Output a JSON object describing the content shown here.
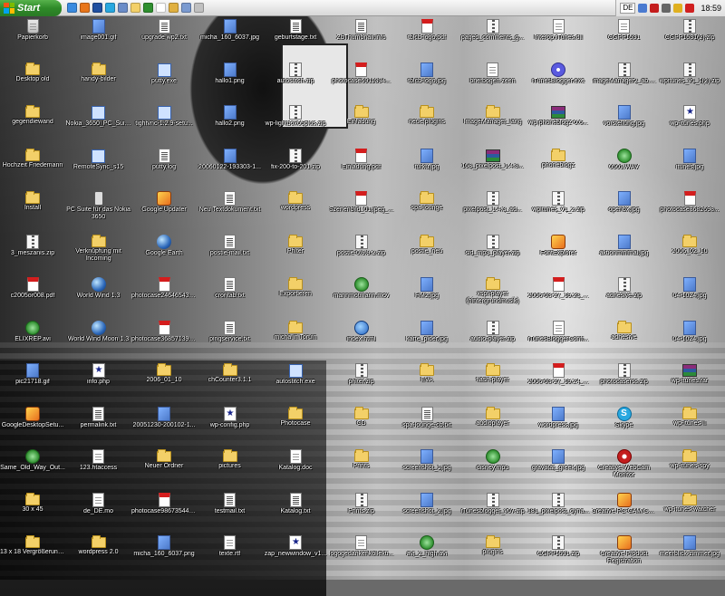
{
  "taskbar": {
    "start_label": "Start",
    "language": "DE",
    "clock": "18:59",
    "quick_launch": [
      "ie-icon",
      "firefox-icon",
      "outlook-icon",
      "skype-icon",
      "desktop-icon",
      "explorer-icon",
      "media-icon",
      "notepad-icon",
      "folder-icon",
      "network-icon",
      "app-icon"
    ],
    "tray_icons": [
      "network-icon",
      "adobe-icon",
      "speaker-icon",
      "safety-icon",
      "antivirus-icon"
    ]
  },
  "desktop": {
    "icons": [
      {
        "label": "Papierkorb",
        "type": "recycle"
      },
      {
        "label": "Desktop old",
        "type": "folder"
      },
      {
        "label": "gegendiewand",
        "type": "folder"
      },
      {
        "label": "Hochzeit Friedemann",
        "type": "folder"
      },
      {
        "label": "Install",
        "type": "folder"
      },
      {
        "label": "3_meszanis.zip",
        "type": "zip"
      },
      {
        "label": "c2005or008.pdf",
        "type": "pdf"
      },
      {
        "label": "ELIXREP.avi",
        "type": "media"
      },
      {
        "label": "pic21718.gif",
        "type": "img"
      },
      {
        "label": "GoogleDesktopSetu...",
        "type": "app"
      },
      {
        "label": "Same_Old_Way_Out...",
        "type": "media"
      },
      {
        "label": "30 x 45",
        "type": "folder"
      },
      {
        "label": "13 x 18 Vergrößerungen",
        "type": "folder"
      },
      {
        "label": "image001.gif",
        "type": "img"
      },
      {
        "label": "handy-bilder",
        "type": "folder"
      },
      {
        "label": "Nokia_3650_PC_Suit...",
        "type": "exe"
      },
      {
        "label": "RemoteSync_s15",
        "type": "exe"
      },
      {
        "label": "PC Suite für das Nokia 3650",
        "type": "phone"
      },
      {
        "label": "Verknüpfung mit Incoming",
        "type": "folder"
      },
      {
        "label": "World Wind 1.3",
        "type": "globe"
      },
      {
        "label": "World Wind Moon 1.3",
        "type": "globe"
      },
      {
        "label": "info.php",
        "type": "php"
      },
      {
        "label": "permalink.txt",
        "type": "txt"
      },
      {
        "label": "123.htaccess",
        "type": "doc"
      },
      {
        "label": "de_DE.mo",
        "type": "doc"
      },
      {
        "label": "wordpress 2.0",
        "type": "folder"
      },
      {
        "label": "upgrade wp2.txt",
        "type": "txt"
      },
      {
        "label": "putty.exe",
        "type": "exe"
      },
      {
        "label": "tightvnc-1.2.9-setu...",
        "type": "exe"
      },
      {
        "label": "putty.log",
        "type": "txt"
      },
      {
        "label": "Google Updater",
        "type": "app"
      },
      {
        "label": "Google Earth",
        "type": "globe"
      },
      {
        "label": "photocase246465434...",
        "type": "pdf"
      },
      {
        "label": "photocase368571390...",
        "type": "pdf"
      },
      {
        "label": "2006_01_10",
        "type": "folder"
      },
      {
        "label": "20051230-200102-1...",
        "type": "img"
      },
      {
        "label": "Neuer Ordner",
        "type": "folder"
      },
      {
        "label": "photocase986735446...",
        "type": "pdf"
      },
      {
        "label": "micha_160_6037.png",
        "type": "img"
      },
      {
        "label": "micha_160_6037.jpg",
        "type": "img"
      },
      {
        "label": "hallo1.png",
        "type": "img"
      },
      {
        "label": "hallo2.png",
        "type": "img"
      },
      {
        "label": "20060122-193303-1...",
        "type": "img"
      },
      {
        "label": "Neu Textdokument.txt",
        "type": "txt"
      },
      {
        "label": "postie-mail.txt",
        "type": "txt"
      },
      {
        "label": "crontab.txt",
        "type": "txt"
      },
      {
        "label": "pingservice.txt",
        "type": "txt"
      },
      {
        "label": "chCounter3.1.1",
        "type": "folder"
      },
      {
        "label": "wp-config.php",
        "type": "php"
      },
      {
        "label": "pictures",
        "type": "folder"
      },
      {
        "label": "testmail.txt",
        "type": "txt"
      },
      {
        "label": "texte.rtf",
        "type": "doc"
      },
      {
        "label": "geburtstage.txt",
        "type": "txt"
      },
      {
        "label": "autostitch.zip",
        "type": "zip"
      },
      {
        "label": "wp-lightbox05plus.zip",
        "type": "zip"
      },
      {
        "label": "fix-200-to-201.zip",
        "type": "zip"
      },
      {
        "label": "wordpress",
        "type": "folder"
      },
      {
        "label": "Phlter",
        "type": "folder"
      },
      {
        "label": "Exportieren",
        "type": "folder"
      },
      {
        "label": "micha in Toruin",
        "type": "folder"
      },
      {
        "label": "autostitch.exe",
        "type": "exe"
      },
      {
        "label": "Photocase",
        "type": "folder"
      },
      {
        "label": "Katalog.doc",
        "type": "doc"
      },
      {
        "label": "Katalog.txt",
        "type": "txt"
      },
      {
        "label": "zap_newwindow_v1...",
        "type": "php"
      },
      {
        "label": "ZbThumbnail.info",
        "type": "txt"
      },
      {
        "label": "photocase6911394...",
        "type": "pdf"
      },
      {
        "label": "Einladung",
        "type": "folder"
      },
      {
        "label": "Einladung.pdf",
        "type": "pdf"
      },
      {
        "label": "Szenenbild_01.jpeg_...",
        "type": "pdf"
      },
      {
        "label": "postie-0.9.9.2.zip",
        "type": "zip"
      },
      {
        "label": "mannmotmann.mov",
        "type": "media"
      },
      {
        "label": "index.html",
        "type": "html"
      },
      {
        "label": "phlter.zip",
        "type": "zip"
      },
      {
        "label": "CD",
        "type": "folder"
      },
      {
        "label": "Prints",
        "type": "folder"
      },
      {
        "label": "Prints.zip",
        "type": "zip"
      },
      {
        "label": "logogedankenkollekti...",
        "type": "doc"
      },
      {
        "label": "tblcb-logo.pdf",
        "type": "pdf"
      },
      {
        "label": "tblcb-logo.jpg",
        "type": "img"
      },
      {
        "label": "neue plugins",
        "type": "folder"
      },
      {
        "label": "turku.jpg",
        "type": "img"
      },
      {
        "label": "spa-lounge",
        "type": "folder"
      },
      {
        "label": "postie_neu",
        "type": "folder"
      },
      {
        "label": "HM2.jpg",
        "type": "img"
      },
      {
        "label": "karte_pider.jpg",
        "type": "img"
      },
      {
        "label": "EVA",
        "type": "folder"
      },
      {
        "label": "spa-lounge-cb.txt",
        "type": "txt"
      },
      {
        "label": "screenshot_1.jpg",
        "type": "img"
      },
      {
        "label": "screenshot_2.jpg",
        "type": "img"
      },
      {
        "label": "avi_2_high.avi",
        "type": "media"
      },
      {
        "label": "paged_comments_g...",
        "type": "zip"
      },
      {
        "label": "briefbogen zeen",
        "type": "doc"
      },
      {
        "label": "ImageManager_lang",
        "type": "folder"
      },
      {
        "label": "168_pixelpost_1.4.3...",
        "type": "rar"
      },
      {
        "label": "pixelpost_1.4.3_ad...",
        "type": "zip"
      },
      {
        "label": "sid_mp3_player.zip",
        "type": "zip"
      },
      {
        "label": "xspf-player (hintergrundmusik)",
        "type": "folder"
      },
      {
        "label": "audio-player.zip",
        "type": "zip"
      },
      {
        "label": "flash-player",
        "type": "folder"
      },
      {
        "label": "audioplayer",
        "type": "folder"
      },
      {
        "label": "disney.mp3",
        "type": "media"
      },
      {
        "label": "iTunesblogger_v07.zip",
        "type": "zip"
      },
      {
        "label": "plugins",
        "type": "folder"
      },
      {
        "label": "Interop.iTunes.dll",
        "type": "doc"
      },
      {
        "label": "iTunesBlogger.exe",
        "type": "wave"
      },
      {
        "label": "wp-phoneblogz-0.6...",
        "type": "rar"
      },
      {
        "label": "phoneblogz",
        "type": "folder"
      },
      {
        "label": "wpitunes_v1_2.zip",
        "type": "zip"
      },
      {
        "label": "FontExplorer",
        "type": "app"
      },
      {
        "label": "2006-03-27_19.23_...",
        "type": "pdf"
      },
      {
        "label": "iTunesBloggerConfi...",
        "type": "doc"
      },
      {
        "label": "2006-03-27_19.24_...",
        "type": "pdf"
      },
      {
        "label": "wordpress.jpg",
        "type": "img"
      },
      {
        "label": "gravatar_greek.jpg",
        "type": "img"
      },
      {
        "label": "181_pixelpost_dyna...",
        "type": "zip"
      },
      {
        "label": "CGPP1531.zip",
        "type": "zip"
      },
      {
        "label": "CGPP1531",
        "type": "doc"
      },
      {
        "label": "ImageManager2_ab.zip",
        "type": "zip"
      },
      {
        "label": "vorstellung.jpg",
        "type": "img"
      },
      {
        "label": "0501.WAV",
        "type": "media"
      },
      {
        "label": "openbx.jpg",
        "type": "img"
      },
      {
        "label": "aktionminimal.jpg",
        "type": "img"
      },
      {
        "label": "adhesive.zip",
        "type": "zip"
      },
      {
        "label": "adhesive",
        "type": "folder"
      },
      {
        "label": "photocaserss.zip",
        "type": "zip"
      },
      {
        "label": "Skype",
        "type": "skype"
      },
      {
        "label": "Creative WebCam Monitor",
        "type": "webcam"
      },
      {
        "label": "Creative PC-CAM Center",
        "type": "app"
      },
      {
        "label": "Creative Product Registration",
        "type": "app"
      },
      {
        "label": "CGPP1531(2).zip",
        "type": "zip"
      },
      {
        "label": "wpitunes_v1_1(2).zip",
        "type": "zip"
      },
      {
        "label": "wp-itunes.php",
        "type": "php"
      },
      {
        "label": "itunes.jpg",
        "type": "img"
      },
      {
        "label": "photocase8682698...",
        "type": "pdf"
      },
      {
        "label": "2006_02_10",
        "type": "folder"
      },
      {
        "label": "04-1024.jpg",
        "type": "img"
      },
      {
        "label": "04-1024.jpg",
        "type": "img"
      },
      {
        "label": "wp-itunes.rar",
        "type": "rar"
      },
      {
        "label": "wp-itunes II",
        "type": "folder"
      },
      {
        "label": "wp-itunes-spy",
        "type": "folder"
      },
      {
        "label": "wp-itunes-watcher",
        "type": "folder"
      },
      {
        "label": "meerblick-zimmer.jpg",
        "type": "img"
      }
    ]
  }
}
